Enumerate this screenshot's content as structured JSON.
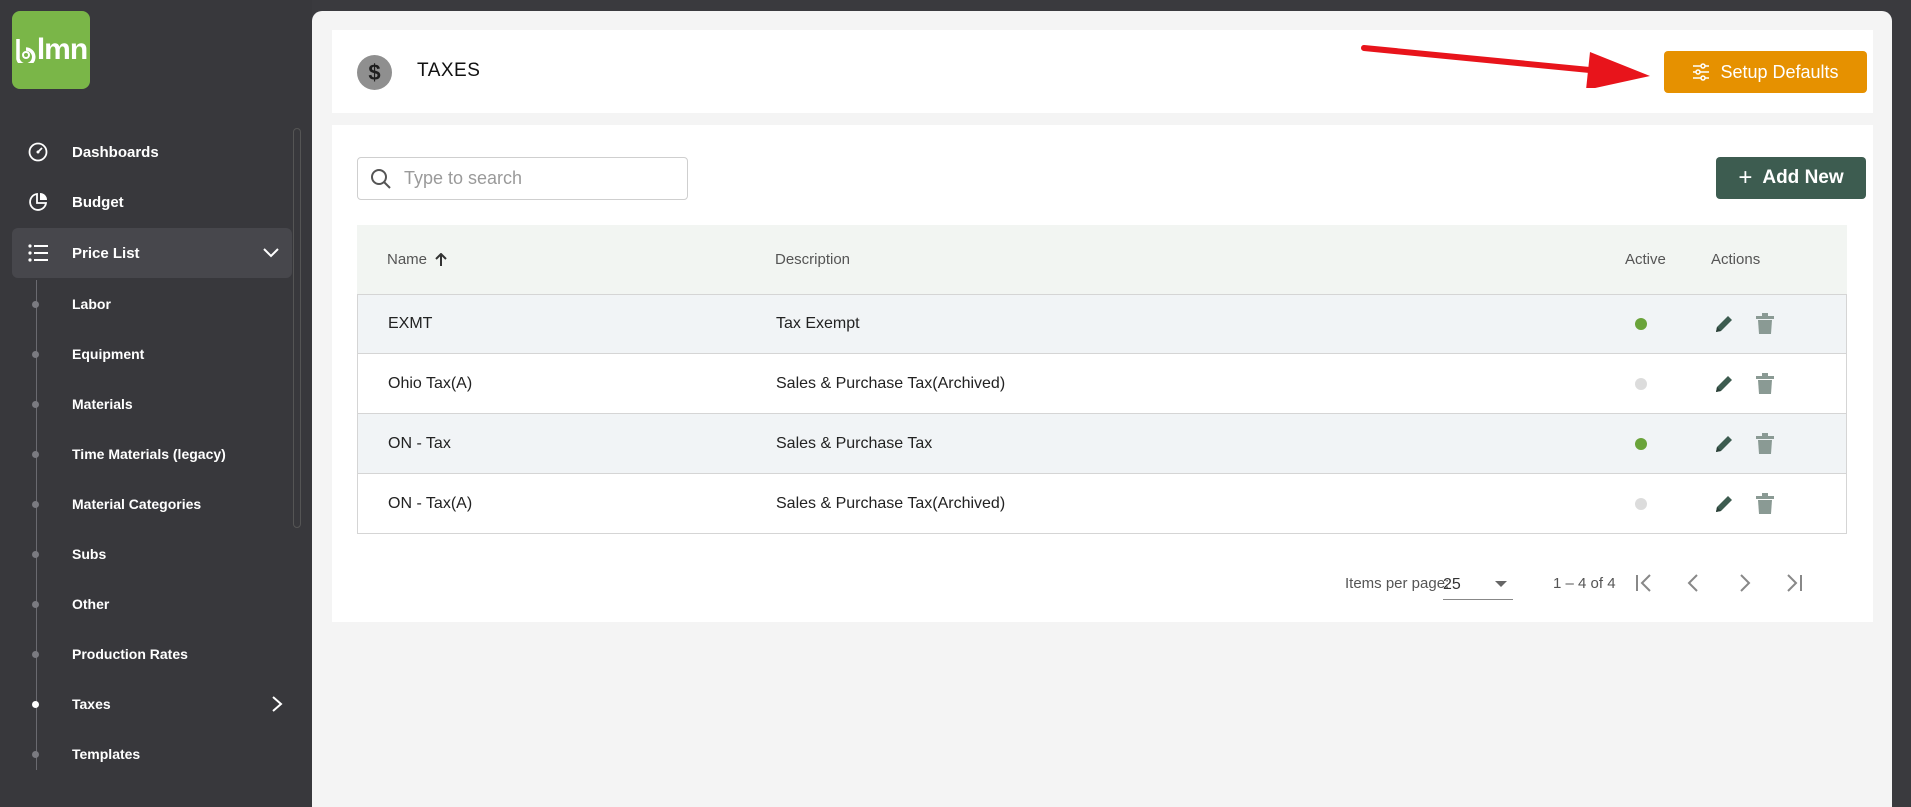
{
  "app": {
    "logo_text": "lmn",
    "brand_color": "#7ab648"
  },
  "sidebar": {
    "items": [
      {
        "label": "Dashboards",
        "icon": "speedometer-icon"
      },
      {
        "label": "Budget",
        "icon": "pie-chart-icon"
      },
      {
        "label": "Price List",
        "icon": "list-icon",
        "expanded": true
      }
    ],
    "sub_items": [
      {
        "label": "Labor"
      },
      {
        "label": "Equipment"
      },
      {
        "label": "Materials"
      },
      {
        "label": "Time Materials (legacy)"
      },
      {
        "label": "Material Categories"
      },
      {
        "label": "Subs"
      },
      {
        "label": "Other"
      },
      {
        "label": "Production Rates"
      },
      {
        "label": "Taxes",
        "current": true
      },
      {
        "label": "Templates"
      }
    ]
  },
  "header": {
    "title": "TAXES",
    "icon": "dollar-icon",
    "setup_label": "Setup Defaults",
    "setup_color": "#e69100"
  },
  "toolbar": {
    "search_placeholder": "Type to search",
    "search_value": "",
    "add_label": "Add New"
  },
  "table": {
    "columns": {
      "name": "Name",
      "description": "Description",
      "active": "Active",
      "actions": "Actions"
    },
    "rows": [
      {
        "name": "EXMT",
        "description": "Tax Exempt",
        "active": true
      },
      {
        "name": "Ohio Tax(A)",
        "description": "Sales & Purchase Tax(Archived)",
        "active": false
      },
      {
        "name": "ON - Tax",
        "description": "Sales & Purchase Tax",
        "active": true
      },
      {
        "name": "ON - Tax(A)",
        "description": "Sales & Purchase Tax(Archived)",
        "active": false
      }
    ]
  },
  "pagination": {
    "items_per_page_label": "Items per page:",
    "items_per_page": "25",
    "range": "1 – 4 of 4"
  },
  "colors": {
    "active": "#6aa33a",
    "inactive": "#dcdcdc",
    "action_icon": "#3d5c50",
    "delete_icon": "#8a9a94"
  }
}
